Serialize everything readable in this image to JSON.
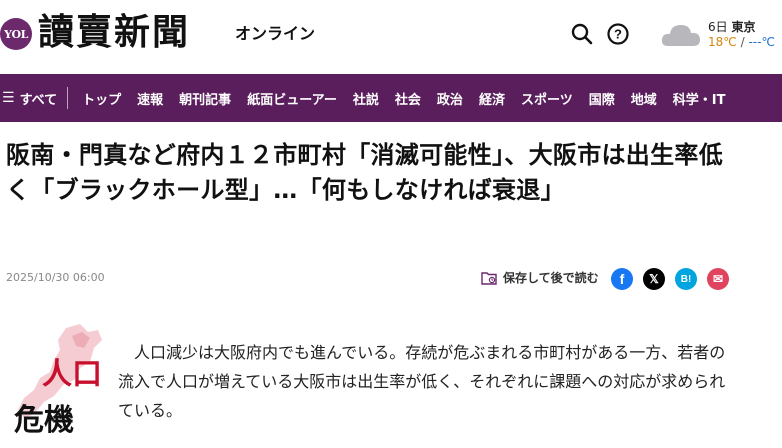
{
  "header": {
    "logo_badge": "YOL",
    "logo_text": "讀賣新聞",
    "logo_sub": "オンライン",
    "icons": [
      "search-icon",
      "help-icon",
      "cloud-icon"
    ]
  },
  "weather": {
    "day": "6日",
    "city": "東京",
    "high": "18℃",
    "separator": "/",
    "low": "---℃"
  },
  "nav": {
    "all_label": "すべて",
    "items": [
      "トップ",
      "速報",
      "朝刊記事",
      "紙面ビューアー",
      "社説",
      "社会",
      "政治",
      "経済",
      "スポーツ",
      "国際",
      "地域",
      "科学・IT"
    ]
  },
  "article": {
    "title": "阪南・門真など府内１２市町村「消滅可能性」、大阪市は出生率低く「ブラックホール型」…「何もしなければ衰退」",
    "date": "2025/10/30 06:00",
    "save_label": "保存して後で読む",
    "share": {
      "facebook": "f",
      "x": "𝕏",
      "hatena": "B!",
      "mail": "✉"
    },
    "series_badge": "人口危機",
    "series_badge_top": "人口",
    "series_badge_bottom": "危機",
    "body": "人口減少は大阪府内でも進んでいる。存続が危ぶまれる市町村がある一方、若者の流入で人口が増えている大阪市は出生率が低く、それぞれに課題への対応が求められている。"
  },
  "colors": {
    "brand_purple": "#5a1e5c",
    "logo_badge": "#6c2a6c",
    "temp_high": "#d4850f",
    "temp_low": "#1e6fd0",
    "facebook": "#1877f2",
    "hatena": "#00a4de",
    "mail": "#e0445e",
    "badge_red": "#c8102e"
  }
}
